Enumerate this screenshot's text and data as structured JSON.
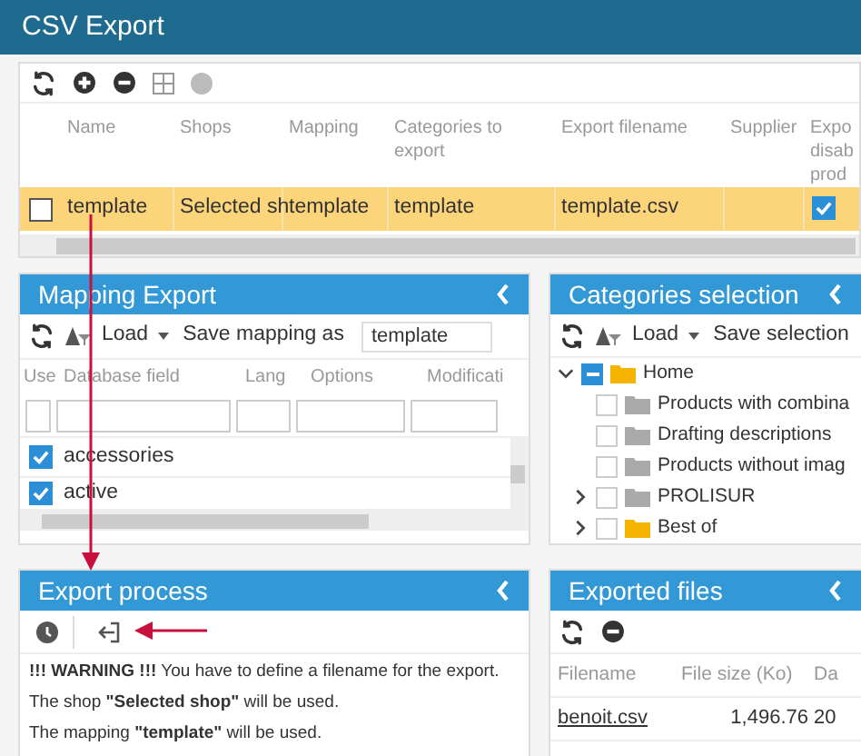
{
  "window": {
    "title": "CSV Export"
  },
  "export_grid": {
    "columns": [
      "Name",
      "Shops",
      "Mapping",
      "Categories to export",
      "Export filename",
      "Supplier",
      "Expo disab prod"
    ],
    "rows": [
      {
        "selected": true,
        "checked": false,
        "cells": [
          "template",
          "Selected sh",
          "template",
          "template",
          "template.csv",
          ""
        ],
        "export_disabled": true
      }
    ]
  },
  "mapping_export": {
    "title": "Mapping Export",
    "load_label": "Load",
    "save_label": "Save mapping as",
    "save_value": "template",
    "columns": [
      "Use",
      "Database field",
      "Lang",
      "Options",
      "Modificati"
    ],
    "rows": [
      {
        "checked": true,
        "field": "accessories"
      },
      {
        "checked": true,
        "field": "active"
      }
    ]
  },
  "categories_selection": {
    "title": "Categories selection",
    "load_label": "Load",
    "save_label": "Save selection",
    "tree": [
      {
        "label": "Home",
        "expanded": true,
        "partial": true,
        "highlight": true,
        "children": [
          {
            "label": "Products with combina",
            "checked": false,
            "highlight": false
          },
          {
            "label": "Drafting descriptions",
            "checked": false,
            "highlight": false
          },
          {
            "label": "Products without imag",
            "checked": false,
            "highlight": false
          },
          {
            "label": "PROLISUR",
            "checked": false,
            "highlight": false,
            "expanded": false
          },
          {
            "label": "Best of",
            "checked": false,
            "highlight": true,
            "expanded": false
          }
        ]
      }
    ]
  },
  "export_process": {
    "title": "Export process",
    "messages": [
      "**!!! WARNING !!!** You have to define a filename for the export.",
      "The shop **\"Selected shop\"** will be used.",
      "The mapping **\"template\"** will be used."
    ]
  },
  "exported_files": {
    "title": "Exported files",
    "columns": [
      "Filename",
      "File size (Ko)",
      "Da"
    ],
    "rows": [
      {
        "cells": [
          "benoit.csv",
          "1,496.76",
          "20"
        ]
      }
    ]
  }
}
